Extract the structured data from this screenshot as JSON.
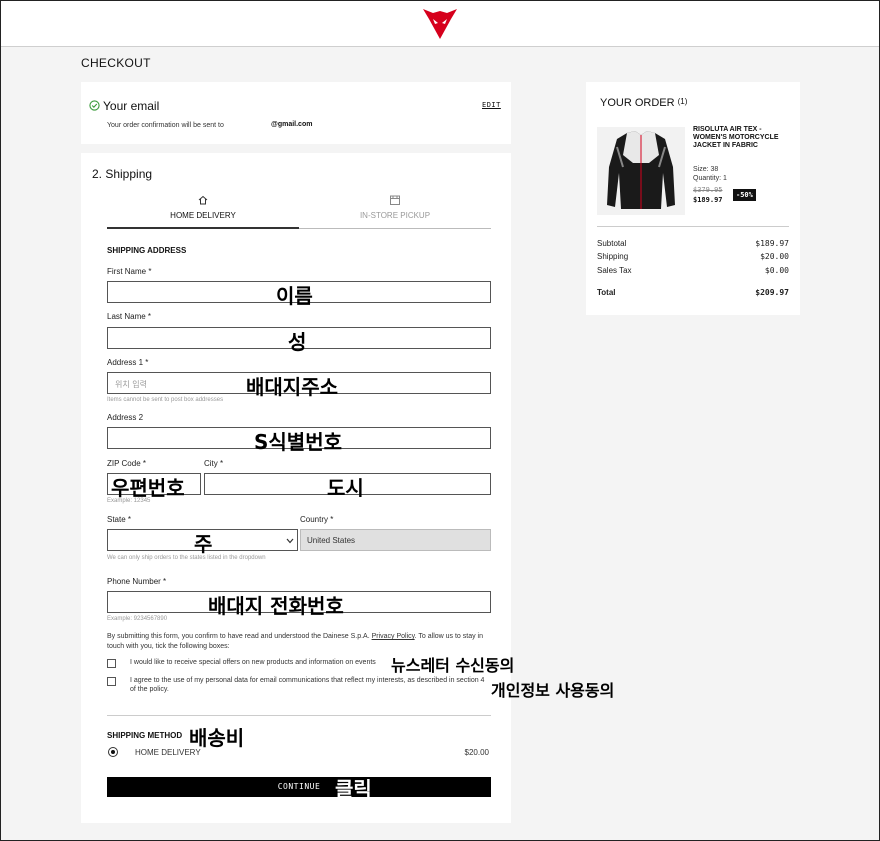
{
  "header": {
    "logo_icon": "dainese-devil-logo-icon",
    "brand_color": "#d6001c"
  },
  "page": {
    "title": "CHECKOUT"
  },
  "email_section": {
    "title": "Your email",
    "edit_label": "EDIT",
    "confirmation_text": "Your order confirmation will be sent to",
    "email_value": "@gmail.com"
  },
  "shipping": {
    "title": "2. Shipping",
    "tabs": [
      {
        "label": "HOME DELIVERY",
        "icon": "home-icon",
        "active": true
      },
      {
        "label": "IN-STORE PICKUP",
        "icon": "store-icon",
        "active": false
      }
    ],
    "address_heading": "SHIPPING ADDRESS",
    "first_name": {
      "label": "First Name *",
      "overlay": "이름"
    },
    "last_name": {
      "label": "Last Name *",
      "overlay": "성"
    },
    "address1": {
      "label": "Address 1 *",
      "placeholder": "위치 입력",
      "overlay": "배대지주소",
      "hint": "Items cannot be sent to post box addresses"
    },
    "address2": {
      "label": "Address 2",
      "overlay": "S식별번호"
    },
    "zip": {
      "label": "ZIP Code *",
      "overlay": "우편번호",
      "hint": "Example: 12345"
    },
    "city": {
      "label": "City *",
      "overlay": "도시"
    },
    "state": {
      "label": "State *",
      "overlay": "주",
      "hint": "We can only ship orders to the states listed in the dropdown"
    },
    "country": {
      "label": "Country *",
      "value": "United States"
    },
    "phone": {
      "label": "Phone Number *",
      "overlay": "배대지 전화번호",
      "hint": "Example: 9234567890"
    },
    "consent_text": "By submitting this form, you confirm to have read and understood the Dainese S.p.A.",
    "privacy_link": "Privacy Policy",
    "consent_text_2": ". To allow us to stay in touch with you, tick the following boxes:",
    "checkbox_offers": {
      "label": "I would like to receive special offers on new products and information on events",
      "overlay": "뉴스레터 수신동의"
    },
    "checkbox_personal": {
      "label": "I agree to the use of my personal data for email communications that reflect my interests, as described in section 4 of the policy.",
      "overlay": "개인정보 사용동의"
    },
    "method_heading": "SHIPPING METHOD",
    "method_overlay": "배송비",
    "method_option": {
      "label": "HOME DELIVERY",
      "price": "$20.00"
    },
    "continue_label": "CONTINUE",
    "continue_overlay": "클릭"
  },
  "order": {
    "title": "YOUR ORDER",
    "count": "(1)",
    "product": {
      "name": "RISOLUTA AIR TEX - WOMEN'S MOTORCYCLE JACKET IN FABRIC",
      "size": "Size: 38",
      "quantity": "Quantity: 1",
      "old_price": "$379.95",
      "discount": "-50%",
      "price": "$189.97"
    },
    "summary": [
      {
        "label": "Subtotal",
        "value": "$189.97"
      },
      {
        "label": "Shipping",
        "value": "$20.00"
      },
      {
        "label": "Sales Tax",
        "value": "$0.00"
      }
    ],
    "total": {
      "label": "Total",
      "value": "$209.97"
    }
  }
}
